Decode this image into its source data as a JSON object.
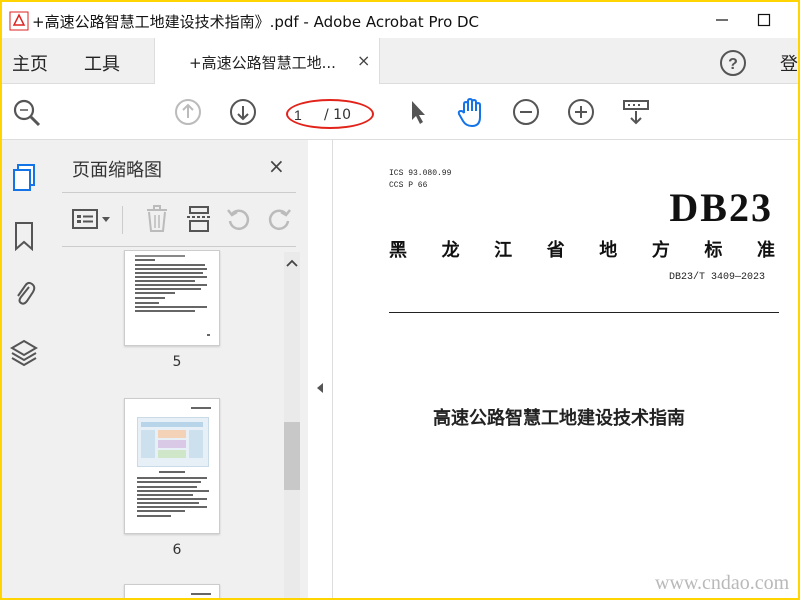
{
  "window": {
    "title": "+高速公路智慧工地建设技术指南》.pdf - Adobe Acrobat Pro DC",
    "minimize_icon": "minimize-icon",
    "maximize_icon": "maximize-icon"
  },
  "menubar": {
    "home": "主页",
    "tools": "工具",
    "doc_tab": "+高速公路智慧工地...",
    "close_tab": "×",
    "help_icon": "help-icon",
    "signin": "登"
  },
  "toolbar": {
    "page_current": "1",
    "page_total": "/ 10",
    "icons": [
      "zoom-search-icon",
      "page-up-icon",
      "page-down-icon",
      "select-arrow-icon",
      "hand-tool-icon",
      "zoom-out-icon",
      "zoom-in-icon",
      "scroll-mode-icon"
    ]
  },
  "panel": {
    "title": "页面缩略图",
    "close": "×",
    "thumbnails": [
      {
        "label": "5"
      },
      {
        "label": "6"
      }
    ]
  },
  "document": {
    "ics": "ICS 93.080.99",
    "ccs": "CCS P 66",
    "code": "DB23",
    "province_chars": [
      "黑",
      "龙",
      "江",
      "省",
      "地",
      "方",
      "标",
      "准"
    ],
    "std_no": "DB23/T 3409—2023",
    "title": "高速公路智慧工地建设技术指南"
  },
  "watermark": "www.cndao.com",
  "colors": {
    "frame": "#ffd400",
    "accent_red": "#e2231a",
    "hand_blue": "#1473e6"
  }
}
